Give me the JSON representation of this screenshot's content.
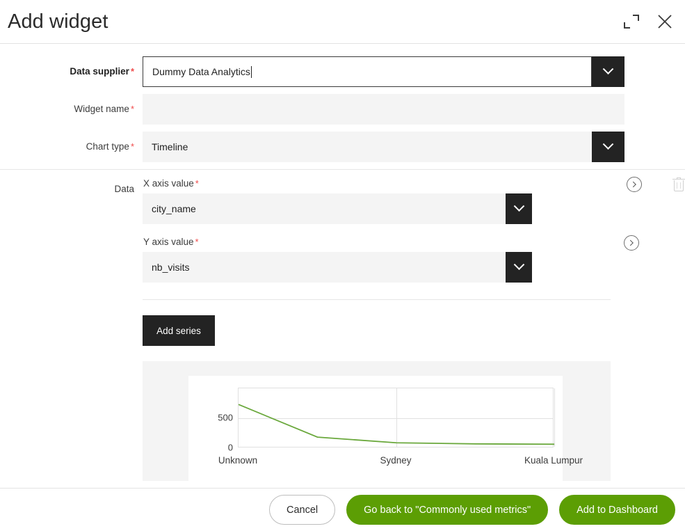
{
  "header": {
    "title": "Add widget",
    "expand_icon": "expand-icon",
    "close_icon": "close-icon"
  },
  "form": {
    "data_supplier": {
      "label": "Data supplier",
      "required": "*",
      "value": "Dummy Data Analytics",
      "placeholder": "",
      "dropdown_icon": "chevron-down-icon"
    },
    "widget_name": {
      "label": "Widget name",
      "required": "*",
      "value": "",
      "placeholder": ""
    },
    "chart_type": {
      "label": "Chart type",
      "required": "*",
      "value": "Timeline",
      "dropdown_icon": "chevron-down-icon"
    }
  },
  "data_section": {
    "label": "Data",
    "expand_icon": "circle-chevron-right-icon",
    "delete_icon": "trash-icon",
    "x_axis": {
      "label": "X axis value",
      "required": "*",
      "value": "city_name",
      "dropdown_icon": "chevron-down-icon"
    },
    "y_axis": {
      "label": "Y axis value",
      "required": "*",
      "value": "nb_visits",
      "dropdown_icon": "chevron-down-icon"
    },
    "add_series_label": "Add series"
  },
  "chart_data": {
    "type": "line",
    "title": "",
    "xlabel": "",
    "ylabel": "",
    "categories": [
      "Unknown",
      "Sydney",
      "Kuala Lumpur"
    ],
    "tick_labels": [
      "Unknown",
      "Sydney",
      "Kuala Lumpur"
    ],
    "ytick_labels": [
      "500",
      "0"
    ],
    "yticks": [
      500,
      0
    ],
    "ylim": [
      0,
      1000
    ],
    "grid": true,
    "legend": "none",
    "series": [
      {
        "name": "nb_visits",
        "color": "#6aa83c",
        "x": [
          0,
          0.5,
          1.0,
          1.5,
          2.0
        ],
        "values": [
          730,
          185,
          90,
          72,
          66
        ]
      }
    ]
  },
  "footer": {
    "cancel_label": "Cancel",
    "go_back_label": "Go back to \"Commonly used metrics\"",
    "add_label": "Add to Dashboard",
    "accent_color": "#5c9e04"
  }
}
